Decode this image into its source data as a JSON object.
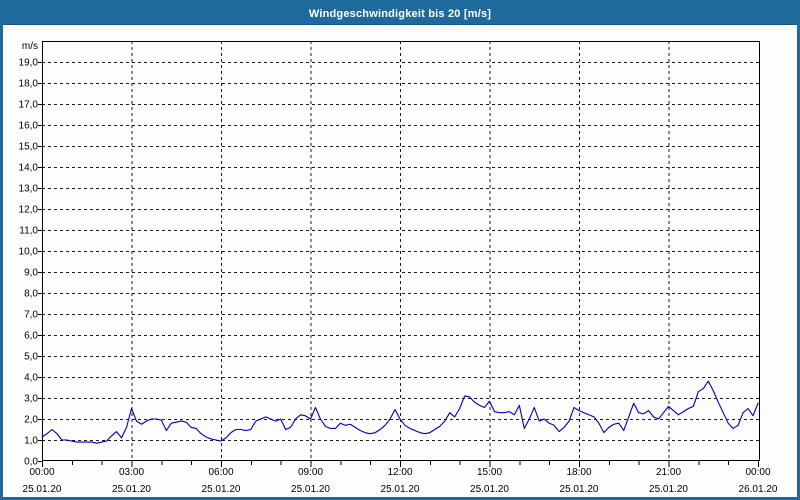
{
  "window": {
    "title": "Windgeschwindigkeit bis 20 [m/s]"
  },
  "colors": {
    "header_bg": "#1e6a9d",
    "frame_border": "#1e6a9d",
    "line": "#0000b4",
    "grid": "#1a1a1a",
    "axis": "#000000",
    "axis_text": "#000000",
    "title_text": "#ffffff",
    "background": "#fcfdfc"
  },
  "chart_data": {
    "type": "line",
    "title": "Windgeschwindigkeit bis 20 [m/s]",
    "ylabel": "m/s",
    "xlabel": "",
    "ylim": [
      0,
      20
    ],
    "y_tick_step": 1.0,
    "y_tick_labels": [
      "0,0",
      "1,0",
      "2,0",
      "3,0",
      "4,0",
      "5,0",
      "6,0",
      "7,0",
      "8,0",
      "9,0",
      "10,0",
      "11,0",
      "12,0",
      "13,0",
      "14,0",
      "15,0",
      "16,0",
      "17,0",
      "18,0",
      "19,0"
    ],
    "x_range_hours": [
      0,
      24
    ],
    "x_major_tick_hours": 3,
    "x_minor_tick_hours": 1,
    "x_ticks": [
      {
        "time": "00:00",
        "date": "25.01.20"
      },
      {
        "time": "03:00",
        "date": "25.01.20"
      },
      {
        "time": "06:00",
        "date": "25.01.20"
      },
      {
        "time": "09:00",
        "date": "25.01.20"
      },
      {
        "time": "12:00",
        "date": "25.01.20"
      },
      {
        "time": "15:00",
        "date": "25.01.20"
      },
      {
        "time": "18:00",
        "date": "25.01.20"
      },
      {
        "time": "21:00",
        "date": "25.01.20"
      },
      {
        "time": "00:00",
        "date": "26.01.20"
      }
    ],
    "grid": "dashed",
    "legend": "none",
    "series": [
      {
        "name": "Windgeschwindigkeit",
        "unit": "m/s",
        "start": "25.01.20 00:00",
        "sample_interval_minutes": 10,
        "values": [
          1.15,
          1.3,
          1.5,
          1.3,
          1.0,
          1.0,
          0.95,
          0.9,
          0.9,
          0.9,
          0.9,
          0.85,
          0.9,
          0.95,
          1.2,
          1.4,
          1.1,
          1.6,
          2.5,
          1.9,
          1.75,
          1.9,
          2.0,
          2.0,
          1.95,
          1.45,
          1.8,
          1.85,
          1.9,
          1.85,
          1.6,
          1.55,
          1.3,
          1.15,
          1.05,
          1.0,
          0.95,
          1.1,
          1.35,
          1.5,
          1.5,
          1.45,
          1.5,
          1.9,
          2.0,
          2.1,
          2.0,
          1.9,
          2.0,
          1.5,
          1.6,
          2.0,
          2.2,
          2.15,
          2.0,
          2.55,
          2.0,
          1.65,
          1.55,
          1.55,
          1.8,
          1.7,
          1.75,
          1.6,
          1.45,
          1.35,
          1.3,
          1.35,
          1.5,
          1.7,
          2.0,
          2.45,
          2.0,
          1.7,
          1.55,
          1.45,
          1.35,
          1.3,
          1.35,
          1.5,
          1.65,
          1.9,
          2.3,
          2.1,
          2.5,
          3.1,
          3.05,
          2.8,
          2.65,
          2.55,
          2.85,
          2.35,
          2.3,
          2.3,
          2.35,
          2.2,
          2.65,
          1.55,
          2.0,
          2.55,
          1.9,
          2.0,
          1.8,
          1.7,
          1.4,
          1.6,
          1.9,
          2.55,
          2.4,
          2.3,
          2.2,
          2.1,
          1.8,
          1.35,
          1.6,
          1.75,
          1.8,
          1.45,
          2.1,
          2.75,
          2.3,
          2.25,
          2.4,
          2.1,
          2.0,
          2.3,
          2.6,
          2.4,
          2.2,
          2.35,
          2.5,
          2.6,
          3.3,
          3.45,
          3.8,
          3.35,
          2.8,
          2.3,
          1.8,
          1.55,
          1.7,
          2.3,
          2.5,
          2.15,
          2.75
        ]
      }
    ]
  }
}
